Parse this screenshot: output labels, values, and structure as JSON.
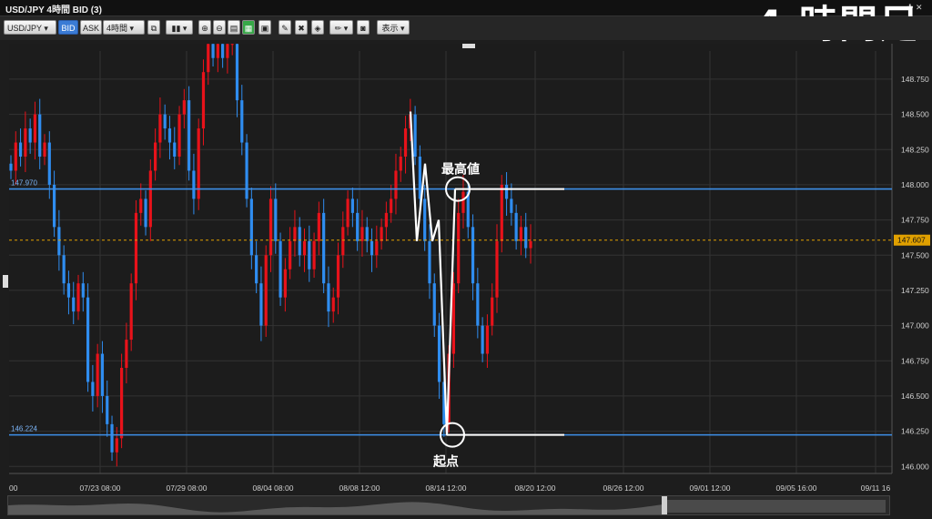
{
  "window": {
    "title": "USD/JPY 4時間 BID (3)",
    "overlay_title": "4 時間足"
  },
  "toolbar": {
    "pair": "USD/JPY",
    "bid_label": "BID",
    "ask_label": "ASK",
    "timeframe": "4時間",
    "display_label": "表示"
  },
  "colors": {
    "bull": "#e8121a",
    "bear": "#2f8df0",
    "grid": "#333333",
    "hline": "#3d8fe8",
    "current": "#e0a000"
  },
  "chart_data": {
    "type": "candlestick",
    "y_ticks": [
      "148.750",
      "148.500",
      "148.250",
      "148.000",
      "147.750",
      "147.500",
      "147.250",
      "147.000",
      "146.750",
      "146.500",
      "146.250",
      "146.000"
    ],
    "ylim": [
      145.95,
      148.95
    ],
    "x_ticks": [
      "07/23 08:00",
      "07/29 08:00",
      "08/04 08:00",
      "08/08 12:00",
      "08/14 12:00",
      "08/20 12:00",
      "08/26 12:00",
      "09/01 12:00",
      "09/05 16:00",
      "09/11 16"
    ],
    "x_tick_left_partial": "00",
    "hlines": [
      {
        "value": 147.97,
        "label": "147.970"
      },
      {
        "value": 146.224,
        "label": "146.224"
      }
    ],
    "current_price": {
      "value": 147.607,
      "label": "147.607"
    },
    "annotations": {
      "high_label": "最高値",
      "start_label": "起点"
    },
    "zigzag": [
      148.52,
      147.6,
      148.15,
      147.6,
      147.75,
      146.22,
      147.97
    ],
    "closes": [
      148.1,
      148.3,
      148.2,
      148.4,
      148.3,
      148.5,
      148.2,
      148.3,
      148.0,
      147.7,
      147.5,
      147.3,
      147.2,
      147.1,
      147.3,
      147.2,
      146.6,
      146.5,
      146.8,
      146.5,
      146.3,
      146.1,
      146.2,
      146.7,
      146.9,
      147.3,
      147.8,
      147.9,
      147.7,
      148.1,
      148.3,
      148.5,
      148.4,
      148.3,
      148.2,
      148.5,
      148.6,
      148.1,
      147.9,
      148.4,
      148.8,
      149.0,
      148.9,
      149.0,
      148.9,
      149.0,
      149.0,
      148.6,
      148.3,
      147.9,
      147.5,
      147.3,
      147.0,
      147.5,
      147.9,
      147.6,
      147.2,
      147.4,
      147.6,
      147.7,
      147.5,
      147.6,
      147.4,
      147.6,
      147.8,
      147.3,
      147.1,
      147.2,
      147.5,
      147.7,
      147.9,
      147.8,
      147.6,
      147.7,
      147.6,
      147.5,
      147.6,
      147.7,
      147.8,
      147.9,
      148.1,
      148.2,
      148.4,
      148.5,
      148.2,
      147.9,
      147.6,
      147.3,
      147.0,
      146.6,
      146.3,
      146.8,
      147.3,
      147.8,
      147.95,
      147.7,
      147.3,
      147.0,
      146.8,
      147.0,
      147.2,
      147.6,
      148.0,
      147.9,
      147.8,
      147.6,
      147.7,
      147.55,
      147.6
    ],
    "candle_x_range": [
      0,
      1
    ]
  }
}
